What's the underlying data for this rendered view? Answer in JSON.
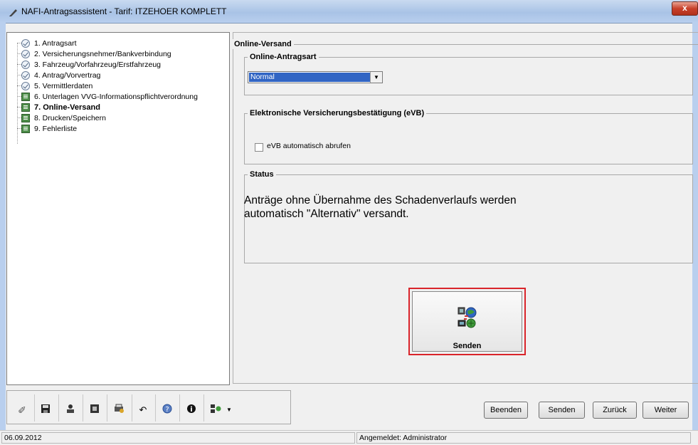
{
  "window": {
    "title": "NAFI-Antragsassistent - Tarif: ITZEHOER KOMPLETT",
    "close_label": "x"
  },
  "tree": {
    "items": [
      {
        "label": "1. Antragsart",
        "icon": "check-circle-icon"
      },
      {
        "label": "2. Versicherungsnehmer/Bankverbindung",
        "icon": "check-circle-icon"
      },
      {
        "label": "3. Fahrzeug/Vorfahrzeug/Erstfahrzeug",
        "icon": "check-circle-icon"
      },
      {
        "label": "4. Antrag/Vorvertrag",
        "icon": "check-circle-icon"
      },
      {
        "label": "5. Vermittlerdaten",
        "icon": "check-circle-icon"
      },
      {
        "label": "6. Unterlagen VVG-Informationspflichtverordnung",
        "icon": "document-icon"
      },
      {
        "label": "7. Online-Versand",
        "icon": "document-icon",
        "selected": true
      },
      {
        "label": "8. Drucken/Speichern",
        "icon": "document-icon"
      },
      {
        "label": "9. Fehlerliste",
        "icon": "document-icon"
      }
    ]
  },
  "main": {
    "section_title": "Online-Versand",
    "antragsart": {
      "legend": "Online-Antragsart",
      "selected": "Normal"
    },
    "evb": {
      "legend": "Elektronische Versicherungsbestätigung (eVB)",
      "checkbox_label": "eVB automatisch abrufen",
      "checked": false
    },
    "status": {
      "legend": "Status",
      "line1": "Anträge ohne Übernahme des Schadenverlaufs werden",
      "line2": "automatisch \"Alternativ\" versandt."
    },
    "send_button_label": "Senden"
  },
  "footer_buttons": {
    "beenden": "Beenden",
    "senden": "Senden",
    "zurueck": "Zurück",
    "weiter": "Weiter"
  },
  "statusbar": {
    "date": "06.09.2012",
    "user": "Angemeldet: Administrator"
  },
  "colors": {
    "highlight": "#d9242a",
    "selection": "#3165c4"
  }
}
